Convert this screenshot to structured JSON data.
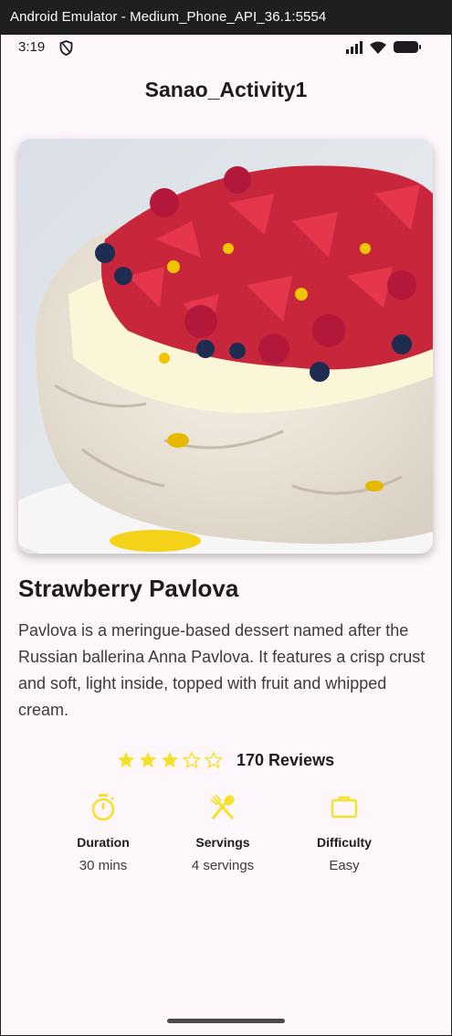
{
  "window": {
    "title": "Android Emulator - Medium_Phone_API_36.1:5554"
  },
  "status_bar": {
    "time": "3:19",
    "icons": [
      "shield-icon",
      "signal-icon",
      "wifi-icon",
      "battery-icon"
    ]
  },
  "app_bar": {
    "title": "Sanao_Activity1"
  },
  "recipe": {
    "image": "pavlova-photo",
    "title": "Strawberry Pavlova",
    "description": "Pavlova is a meringue-based dessert named after the Russian ballerina Anna Pavlova. It features a crisp crust and soft, light inside, topped with fruit and whipped cream.",
    "rating": {
      "value": 3,
      "max": 5,
      "reviews_label": "170 Reviews"
    },
    "info": [
      {
        "icon": "timer-icon",
        "label": "Duration",
        "value": "30 mins"
      },
      {
        "icon": "fork-knife-icon",
        "label": "Servings",
        "value": "4 servings"
      },
      {
        "icon": "briefcase-icon",
        "label": "Difficulty",
        "value": "Easy"
      }
    ]
  },
  "colors": {
    "accent": "#f5e12a",
    "background": "#fdf7fb",
    "text": "#1d1b20"
  }
}
